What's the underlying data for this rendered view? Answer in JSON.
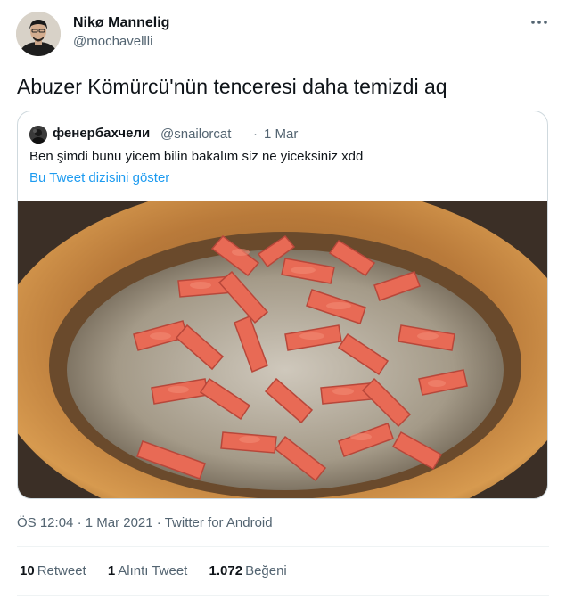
{
  "author": {
    "name": "Nikø Mannelig",
    "handle": "@mochavellli",
    "more_icon": "more-dots-icon"
  },
  "tweet": {
    "text": "Abuzer Kömürcü'nün tenceresi daha temizdi aq"
  },
  "quoted": {
    "name": "фенербахчели",
    "handle": "@snailorcat",
    "separator": "·",
    "date": "1 Mar",
    "text": "Ben şimdi bunu yicem bilin bakalım siz ne yiceksiniz xdd",
    "thread_link": "Bu Tweet dizisini göster",
    "image_desc_icon": "sausages-in-pot-photo"
  },
  "meta": {
    "time": "ÖS 12:04",
    "sep1": "·",
    "date": "1 Mar 2021",
    "sep2": "·",
    "source": "Twitter for Android"
  },
  "stats": {
    "retweets_count": "10",
    "retweets_label": "Retweet",
    "quotes_count": "1",
    "quotes_label": "Alıntı Tweet",
    "likes_count": "1.072",
    "likes_label": "Beğeni"
  },
  "colors": {
    "link": "#1d9bf0",
    "secondary_text": "#536471",
    "border": "#cfd9de"
  }
}
